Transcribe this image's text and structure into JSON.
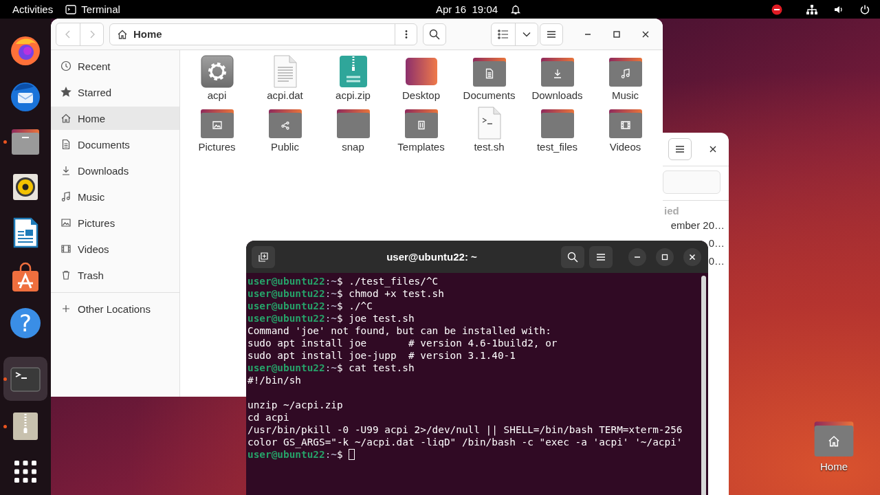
{
  "top_bar": {
    "activities": "Activities",
    "app": "Terminal",
    "clock": "Apr 16  19:04"
  },
  "dock": {
    "items": [
      {
        "kind": "firefox",
        "running": false,
        "selected": false
      },
      {
        "kind": "thunderbird",
        "running": false,
        "selected": false
      },
      {
        "kind": "files",
        "running": true,
        "selected": false
      },
      {
        "kind": "rhythmbox",
        "running": false,
        "selected": false
      },
      {
        "kind": "writer",
        "running": false,
        "selected": false
      },
      {
        "kind": "software",
        "running": false,
        "selected": false
      },
      {
        "kind": "help",
        "running": false,
        "selected": false,
        "glyph": "?"
      },
      {
        "kind": "terminal",
        "running": true,
        "selected": true
      },
      {
        "kind": "archive",
        "running": true,
        "selected": false
      },
      {
        "kind": "apps",
        "running": false,
        "selected": false
      }
    ]
  },
  "files_window": {
    "path": "Home",
    "sidebar": [
      {
        "kind": "recent",
        "label": "Recent",
        "selected": false
      },
      {
        "kind": "starred",
        "label": "Starred",
        "selected": false
      },
      {
        "kind": "home",
        "label": "Home",
        "selected": true
      },
      {
        "kind": "documents",
        "label": "Documents",
        "selected": false
      },
      {
        "kind": "downloads",
        "label": "Downloads",
        "selected": false
      },
      {
        "kind": "music",
        "label": "Music",
        "selected": false
      },
      {
        "kind": "pictures",
        "label": "Pictures",
        "selected": false
      },
      {
        "kind": "videos",
        "label": "Videos",
        "selected": false
      },
      {
        "kind": "trash",
        "label": "Trash",
        "selected": false
      }
    ],
    "other_locations": "Other Locations",
    "items": [
      {
        "kind": "app",
        "name": "acpi"
      },
      {
        "kind": "text",
        "name": "acpi.dat"
      },
      {
        "kind": "archive",
        "name": "acpi.zip"
      },
      {
        "kind": "desktop",
        "name": "Desktop"
      },
      {
        "kind": "documents",
        "name": "Documents"
      },
      {
        "kind": "downloads",
        "name": "Downloads"
      },
      {
        "kind": "music",
        "name": "Music"
      },
      {
        "kind": "pictures",
        "name": "Pictures"
      },
      {
        "kind": "share",
        "name": "Public"
      },
      {
        "kind": "folder",
        "name": "snap"
      },
      {
        "kind": "templates",
        "name": "Templates"
      },
      {
        "kind": "script",
        "name": "test.sh"
      },
      {
        "kind": "folder",
        "name": "test_files"
      },
      {
        "kind": "videos",
        "name": "Videos"
      }
    ]
  },
  "back_window": {
    "column": "ied",
    "rows": [
      "ember 20…",
      "0…",
      "0…"
    ]
  },
  "terminal": {
    "title": "user@ubuntu22: ~",
    "cursor": true,
    "lines": [
      {
        "kind": "prompt",
        "user": "user@ubuntu22",
        "dir": ":~",
        "sign": "$ ",
        "command": "./test_files/^C"
      },
      {
        "kind": "prompt",
        "user": "user@ubuntu22",
        "dir": ":~",
        "sign": "$ ",
        "command": "chmod +x test.sh"
      },
      {
        "kind": "prompt",
        "user": "user@ubuntu22",
        "dir": ":~",
        "sign": "$ ",
        "command": "./^C"
      },
      {
        "kind": "prompt",
        "user": "user@ubuntu22",
        "dir": ":~",
        "sign": "$ ",
        "command": "joe test.sh"
      },
      {
        "kind": "output",
        "text": "Command 'joe' not found, but can be installed with:"
      },
      {
        "kind": "output",
        "text": "sudo apt install joe       # version 4.6-1build2, or"
      },
      {
        "kind": "output",
        "text": "sudo apt install joe-jupp  # version 3.1.40-1"
      },
      {
        "kind": "prompt",
        "user": "user@ubuntu22",
        "dir": ":~",
        "sign": "$ ",
        "command": "cat test.sh"
      },
      {
        "kind": "output",
        "text": "#!/bin/sh"
      },
      {
        "kind": "blank"
      },
      {
        "kind": "output",
        "text": "unzip ~/acpi.zip"
      },
      {
        "kind": "output",
        "text": "cd acpi"
      },
      {
        "kind": "output",
        "text": "/usr/bin/pkill -0 -U99 acpi 2>/dev/null || SHELL=/bin/bash TERM=xterm-256"
      },
      {
        "kind": "output",
        "text": "color GS_ARGS=\"-k ~/acpi.dat -liqD\" /bin/bash -c \"exec -a 'acpi' '~/acpi'"
      },
      {
        "kind": "prompt",
        "user": "user@ubuntu22",
        "dir": ":~",
        "sign": "$ "
      }
    ]
  },
  "desktop_icons": [
    {
      "label": "Home",
      "kind": "home"
    }
  ]
}
